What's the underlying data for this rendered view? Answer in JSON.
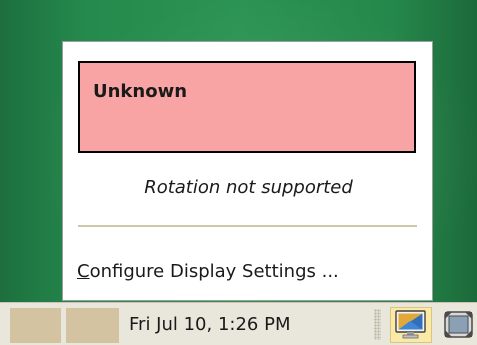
{
  "popup": {
    "status": "Unknown",
    "rotation_message": "Rotation not supported",
    "configure_mnemonic": "C",
    "configure_rest": "onfigure Display Settings ..."
  },
  "panel": {
    "clock": "Fri Jul 10,  1:26 PM",
    "tray_icons": [
      "display-settings-icon",
      "screen-resize-icon"
    ]
  },
  "colors": {
    "desktop": "#258a4d",
    "status_box": "#f9a4a4",
    "panel": "#e9e6dc",
    "panel_block": "#d4c3a0",
    "tray_highlight": "#fbeaa7"
  }
}
